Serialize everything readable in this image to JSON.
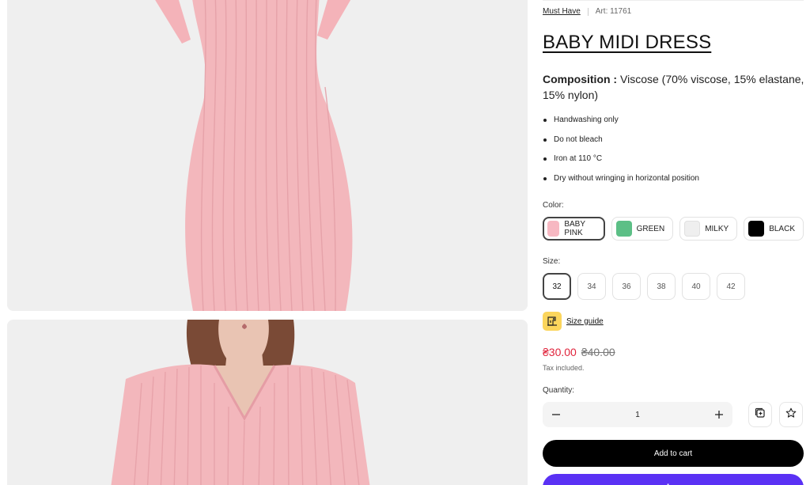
{
  "breadcrumb": {
    "collection": "Must Have",
    "article": "Art: 11761"
  },
  "product": {
    "title": "BABY MIDI DRESS",
    "composition_label": "Composition :",
    "composition_value": "Viscose (70% viscose, 15% elastane, 15% nylon)",
    "care": [
      "Handwashing only",
      "Do not bleach",
      "Iron at 110 °C",
      "Dry without wringing in horizontal position"
    ]
  },
  "color": {
    "label": "Color:",
    "options": [
      {
        "name": "BABY PINK",
        "hex": "#f7b8c2",
        "selected": true
      },
      {
        "name": "GREEN",
        "hex": "#5cbf86",
        "selected": false
      },
      {
        "name": "MILKY",
        "hex": "#efefef",
        "selected": false
      },
      {
        "name": "BLACK",
        "hex": "#000000",
        "selected": false
      }
    ]
  },
  "size": {
    "label": "Size:",
    "options": [
      "32",
      "34",
      "36",
      "38",
      "40",
      "42"
    ],
    "selected": "32",
    "guide_label": "Size guide",
    "guide_icon": "sewing-machine-icon"
  },
  "price": {
    "current": "₴30.00",
    "old": "₴40.00",
    "tax_note": "Tax included."
  },
  "quantity": {
    "label": "Quantity:",
    "value": "1",
    "minus_icon": "minus-icon",
    "plus_icon": "plus-icon"
  },
  "actions": {
    "compare_icon": "compare-icon",
    "wishlist_icon": "star-icon",
    "add_to_cart": "Add to cart",
    "shop_pay": "shop"
  },
  "colors": {
    "price_accent": "#e0243c",
    "shop_pay_bg": "#5a31f4",
    "product_pink": "#f3b7bc"
  }
}
